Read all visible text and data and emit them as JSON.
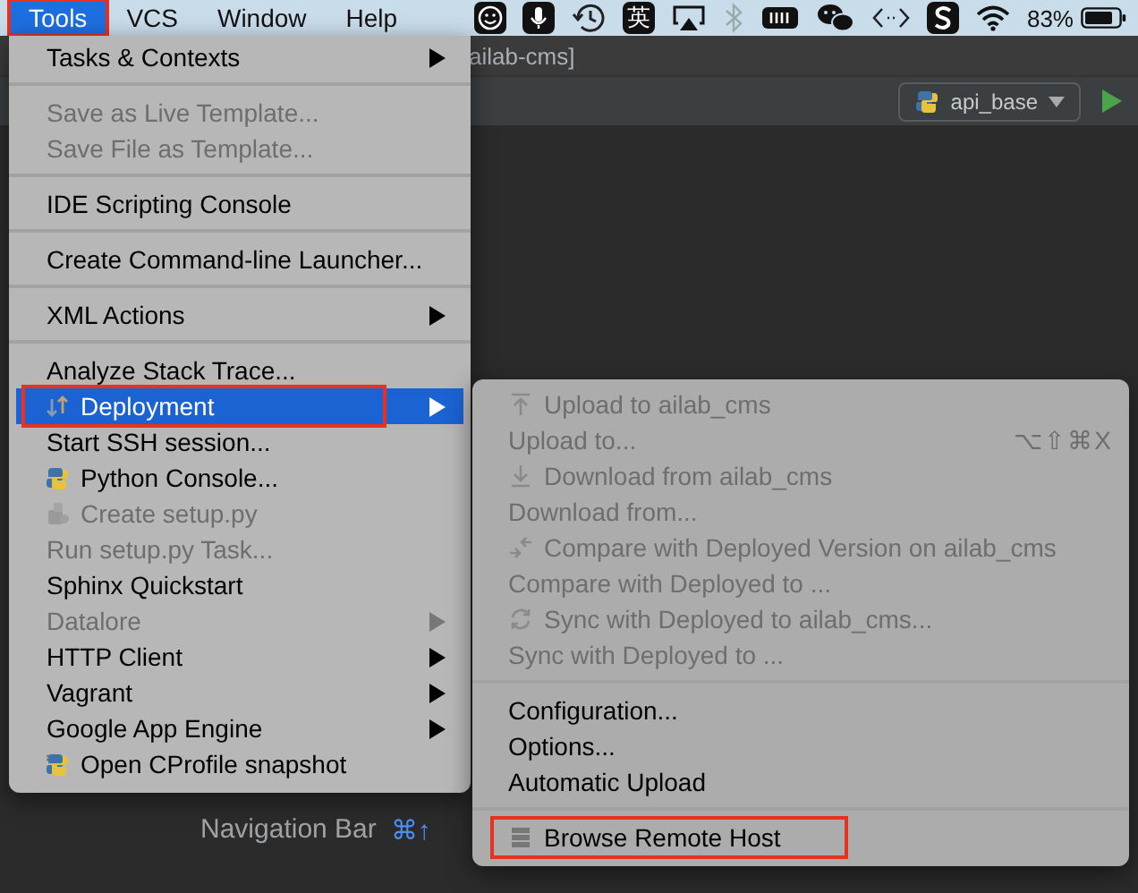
{
  "menubar": {
    "items": [
      {
        "label": "Tools",
        "selected": true,
        "marked": true
      },
      {
        "label": "VCS",
        "selected": false,
        "marked": false
      },
      {
        "label": "Window",
        "selected": false,
        "marked": false
      },
      {
        "label": "Help",
        "selected": false,
        "marked": false
      }
    ],
    "input_method": "英",
    "battery_percent": "83%"
  },
  "window": {
    "title_fragment": "ailab-cms]",
    "run_config": "api_base"
  },
  "tools_menu": {
    "items": [
      {
        "kind": "item",
        "label": "Tasks & Contexts",
        "disabled": false,
        "submenu": true,
        "selected": false,
        "marked": false
      },
      {
        "kind": "separator"
      },
      {
        "kind": "item",
        "label": "Save as Live Template...",
        "disabled": true,
        "submenu": false,
        "selected": false,
        "marked": false
      },
      {
        "kind": "item",
        "label": "Save File as Template...",
        "disabled": true,
        "submenu": false,
        "selected": false,
        "marked": false
      },
      {
        "kind": "separator"
      },
      {
        "kind": "item",
        "label": "IDE Scripting Console",
        "disabled": false,
        "submenu": false,
        "selected": false,
        "marked": false
      },
      {
        "kind": "separator"
      },
      {
        "kind": "item",
        "label": "Create Command-line Launcher...",
        "disabled": false,
        "submenu": false,
        "selected": false,
        "marked": false
      },
      {
        "kind": "separator"
      },
      {
        "kind": "item",
        "label": "XML Actions",
        "disabled": false,
        "submenu": true,
        "selected": false,
        "marked": false
      },
      {
        "kind": "separator"
      },
      {
        "kind": "item",
        "label": "Analyze Stack Trace...",
        "disabled": false,
        "submenu": false,
        "selected": false,
        "marked": false
      },
      {
        "kind": "item",
        "label": "Deployment",
        "disabled": false,
        "submenu": true,
        "selected": true,
        "marked": true
      },
      {
        "kind": "item",
        "label": "Start SSH session...",
        "disabled": false,
        "submenu": false,
        "selected": false,
        "marked": false
      },
      {
        "kind": "item",
        "label": "Python Console...",
        "disabled": false,
        "submenu": false,
        "selected": false,
        "marked": false
      },
      {
        "kind": "item",
        "label": "Create setup.py",
        "disabled": true,
        "submenu": false,
        "selected": false,
        "marked": false
      },
      {
        "kind": "item",
        "label": "Run setup.py Task...",
        "disabled": true,
        "submenu": false,
        "selected": false,
        "marked": false
      },
      {
        "kind": "item",
        "label": "Sphinx Quickstart",
        "disabled": false,
        "submenu": false,
        "selected": false,
        "marked": false
      },
      {
        "kind": "item",
        "label": "Datalore",
        "disabled": true,
        "submenu": true,
        "selected": false,
        "marked": false
      },
      {
        "kind": "item",
        "label": "HTTP Client",
        "disabled": false,
        "submenu": true,
        "selected": false,
        "marked": false
      },
      {
        "kind": "item",
        "label": "Vagrant",
        "disabled": false,
        "submenu": true,
        "selected": false,
        "marked": false
      },
      {
        "kind": "item",
        "label": "Google App Engine",
        "disabled": false,
        "submenu": true,
        "selected": false,
        "marked": false
      },
      {
        "kind": "item",
        "label": "Open CProfile snapshot",
        "disabled": false,
        "submenu": false,
        "selected": false,
        "marked": false
      }
    ]
  },
  "deployment_menu": {
    "items": [
      {
        "kind": "item",
        "label": "Upload to ailab_cms",
        "disabled": true,
        "marked": false
      },
      {
        "kind": "item",
        "label": "Upload to...",
        "shortcut": "⌥⇧⌘X",
        "disabled": true,
        "marked": false
      },
      {
        "kind": "item",
        "label": "Download from ailab_cms",
        "disabled": true,
        "marked": false
      },
      {
        "kind": "item",
        "label": "Download from...",
        "disabled": true,
        "marked": false
      },
      {
        "kind": "item",
        "label": "Compare with Deployed Version on ailab_cms",
        "disabled": true,
        "marked": false
      },
      {
        "kind": "item",
        "label": "Compare with Deployed to ...",
        "disabled": true,
        "marked": false
      },
      {
        "kind": "item",
        "label": "Sync with Deployed to ailab_cms...",
        "disabled": true,
        "marked": false
      },
      {
        "kind": "item",
        "label": "Sync with Deployed to ...",
        "disabled": true,
        "marked": false
      },
      {
        "kind": "separator"
      },
      {
        "kind": "item",
        "label": "Configuration...",
        "disabled": false,
        "marked": false
      },
      {
        "kind": "item",
        "label": "Options...",
        "disabled": false,
        "marked": false
      },
      {
        "kind": "item",
        "label": "Automatic Upload",
        "disabled": false,
        "marked": false
      },
      {
        "kind": "separator"
      },
      {
        "kind": "item",
        "label": "Browse Remote Host",
        "disabled": false,
        "marked": true
      }
    ]
  },
  "editor_hints": [
    {
      "label": "Navigation Bar",
      "shortcut": "⌘↑"
    }
  ]
}
